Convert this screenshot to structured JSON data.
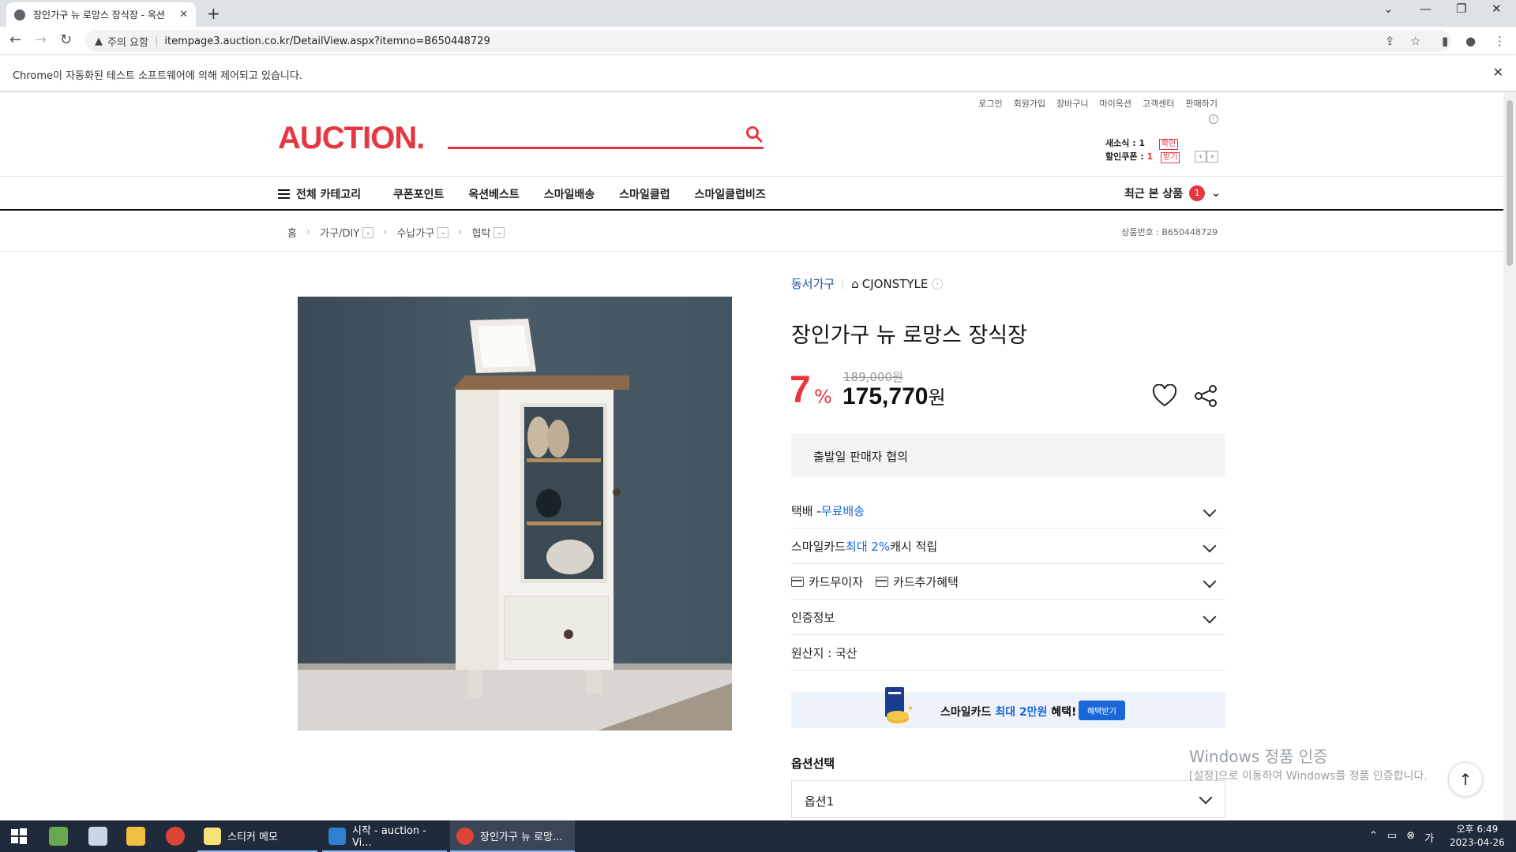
{
  "browser": {
    "tab_title": "장인가구 뉴 로망스 장식장 - 옥션",
    "tab_close": "✕",
    "new_tab": "+",
    "security_label": "주의 요함",
    "url": "itempage3.auction.co.kr/DetailView.aspx?itemno=B650448729",
    "infobar_text": "Chrome이 자동화된 테스트 소프트웨어에 의해 제어되고 있습니다.",
    "infobar_close": "✕"
  },
  "site": {
    "logo": "AUCTION.",
    "util_links": [
      "로그인",
      "회원가입",
      "장바구니",
      "마이옥션",
      "고객센터",
      "판매하기"
    ],
    "news_label": "새소식 : ",
    "news_count": "1",
    "news_btn": "확인",
    "coupon_label": "할인쿠폰 : ",
    "coupon_count": "1",
    "coupon_btn": "받기",
    "gnb": {
      "all_category": "전체 카테고리",
      "menus": [
        "쿠폰포인트",
        "옥션베스트",
        "스마일배송",
        "스마일클럽",
        "스마일클럽비즈"
      ],
      "recent": "최근 본 상품",
      "recent_count": "1"
    },
    "breadcrumb": {
      "home": "홈",
      "levels": [
        "가구/DIY",
        "수납가구",
        "협탁"
      ],
      "product_no": "상품번호 : B650448729"
    }
  },
  "product": {
    "category_link": "동서가구",
    "store": "CJONSTYLE",
    "title": "장인가구 뉴 로망스 장식장",
    "discount": "7",
    "discount_unit": "%",
    "original_price": "189,000원",
    "price": "175,770",
    "price_unit": "원",
    "ship_notice": "출발일 판매자 협의",
    "shipping_prefix": "택배 - ",
    "shipping_free": "무료배송",
    "smilecard_prefix": "스마일카드 ",
    "smilecard_highlight": "최대 2%",
    "smilecard_suffix": " 캐시 적립",
    "card_interest": "카드무이자",
    "card_benefit": "카드추가혜택",
    "certification": "인증정보",
    "origin": "원산지 : 국산",
    "banner_prefix": "스마일카드 ",
    "banner_highlight": "최대 2만원",
    "banner_suffix": " 혜택!",
    "banner_button": "혜택받기",
    "option_label": "옵션선택",
    "option_value": "옵션1"
  },
  "os": {
    "watermark_title": "Windows 정품 인증",
    "watermark_sub": "[설정]으로 이동하여 Windows를 정품 인증합니다.",
    "taskbar_items": [
      "스티커 메모",
      "시작 - auction - Vi...",
      "장인가구 뉴 로망..."
    ],
    "clock_time": "오후 6:49",
    "clock_date": "2023-04-26"
  }
}
